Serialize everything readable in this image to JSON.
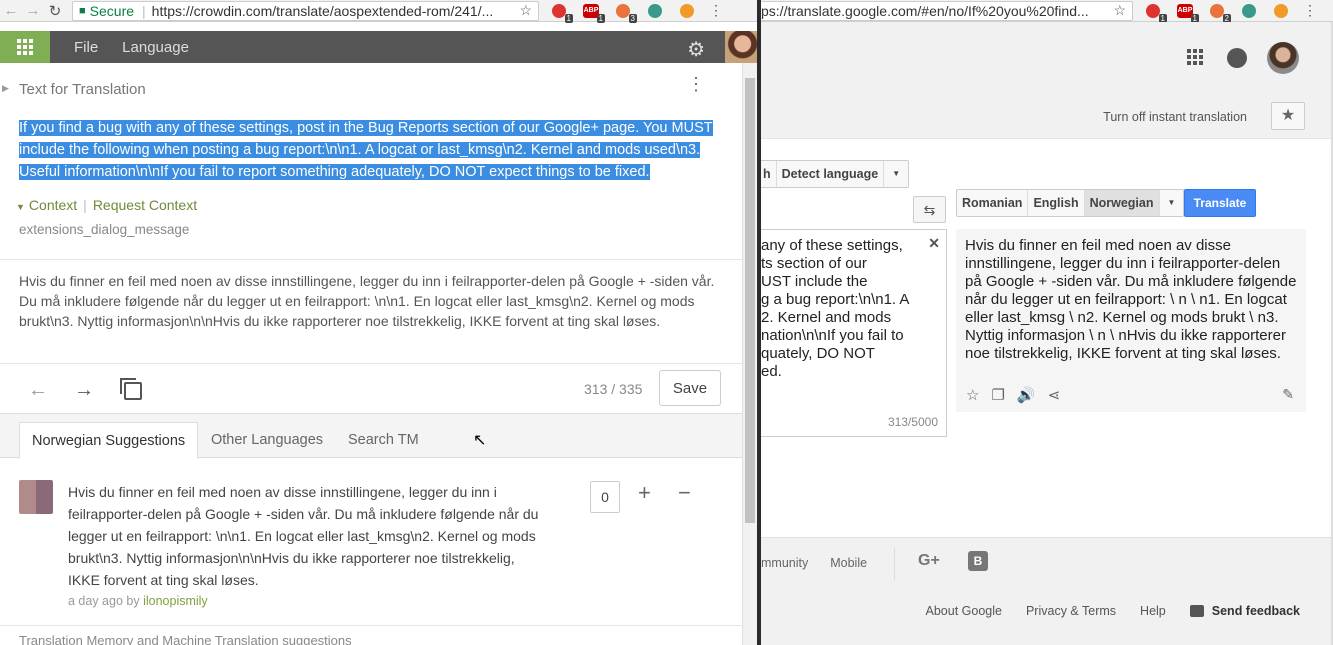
{
  "left_browser": {
    "secure_label": "Secure",
    "url": "https://crowdin.com/translate/aospextended-rom/241/...",
    "ext_badges": [
      "1",
      "1",
      "3"
    ]
  },
  "right_browser": {
    "url": "ps://translate.google.com/#en/no/If%20you%20find...",
    "ext_badges": [
      "1",
      "1",
      "2"
    ]
  },
  "crowdin": {
    "menu": [
      "File",
      "Language"
    ],
    "section_title": "Text for Translation",
    "source_text": "If you find a bug with any of these settings, post in the Bug Reports section of our Google+ page. You MUST include the following when posting a bug report:\\n\\n1. A logcat or last_kmsg\\n2. Kernel and mods used\\n3. Useful information\\n\\nIf you fail to report something adequately, DO NOT expect things to be fixed.",
    "context_label": "Context",
    "request_context_label": "Request Context",
    "string_key": "extensions_dialog_message",
    "translation_text": "Hvis du finner en feil med noen av disse innstillingene, legger du inn i feilrapporter-delen på Google + -siden vår. Du må inkludere følgende når du legger ut en feilrapport: \\n\\n1. En logcat eller last_kmsg\\n2. Kernel og mods brukt\\n3. Nyttig informasjon\\n\\nHvis du ikke rapporterer noe tilstrekkelig, IKKE forvent at ting skal løses.",
    "counter": "313 / 335",
    "save_label": "Save",
    "tabs": [
      "Norwegian Suggestions",
      "Other Languages",
      "Search TM"
    ],
    "suggestion": {
      "text": "Hvis du finner en feil med noen av disse innstillingene, legger du inn i feilrapporter-delen på Google + -siden vår. Du må inkludere følgende når du legger ut en feilrapport: \\n\\n1. En logcat eller last_kmsg\\n2. Kernel og mods brukt\\n3. Nyttig informasjon\\n\\nHvis du ikke rapporterer noe tilstrekkelig, IKKE forvent at ting skal løses.",
      "time": "a day ago by",
      "author": "ilonopismily",
      "votes": "0"
    },
    "tm_label": "Translation Memory and Machine Translation suggestions"
  },
  "gtranslate": {
    "instant_label": "Turn off instant translation",
    "source_lang_partial": "h",
    "detect_language": "Detect language",
    "target_langs": [
      "Romanian",
      "English",
      "Norwegian"
    ],
    "translate_label": "Translate",
    "source_visible": "any of these settings,\nts section of our\nUST include the\ng a bug report:\\n\\n1. A\n2. Kernel and mods\nnation\\n\\nIf you fail to\nquately, DO NOT\ned.",
    "char_count": "313/5000",
    "target_text": "Hvis du finner en feil med noen av disse innstillingene, legger du inn i feilrapporter-delen på Google + -siden vår. Du må inkludere følgende når du legger ut en feilrapport: \\ n \\ n1. En logcat eller last_kmsg \\ n2. Kernel og mods brukt \\ n3. Nyttig informasjon \\ n \\ nHvis du ikke rapporterer noe tilstrekkelig, IKKE forvent at ting skal løses.",
    "footer_links": [
      "mmunity",
      "Mobile"
    ],
    "bottom_links": [
      "About Google",
      "Privacy & Terms",
      "Help"
    ],
    "feedback_label": "Send feedback"
  }
}
